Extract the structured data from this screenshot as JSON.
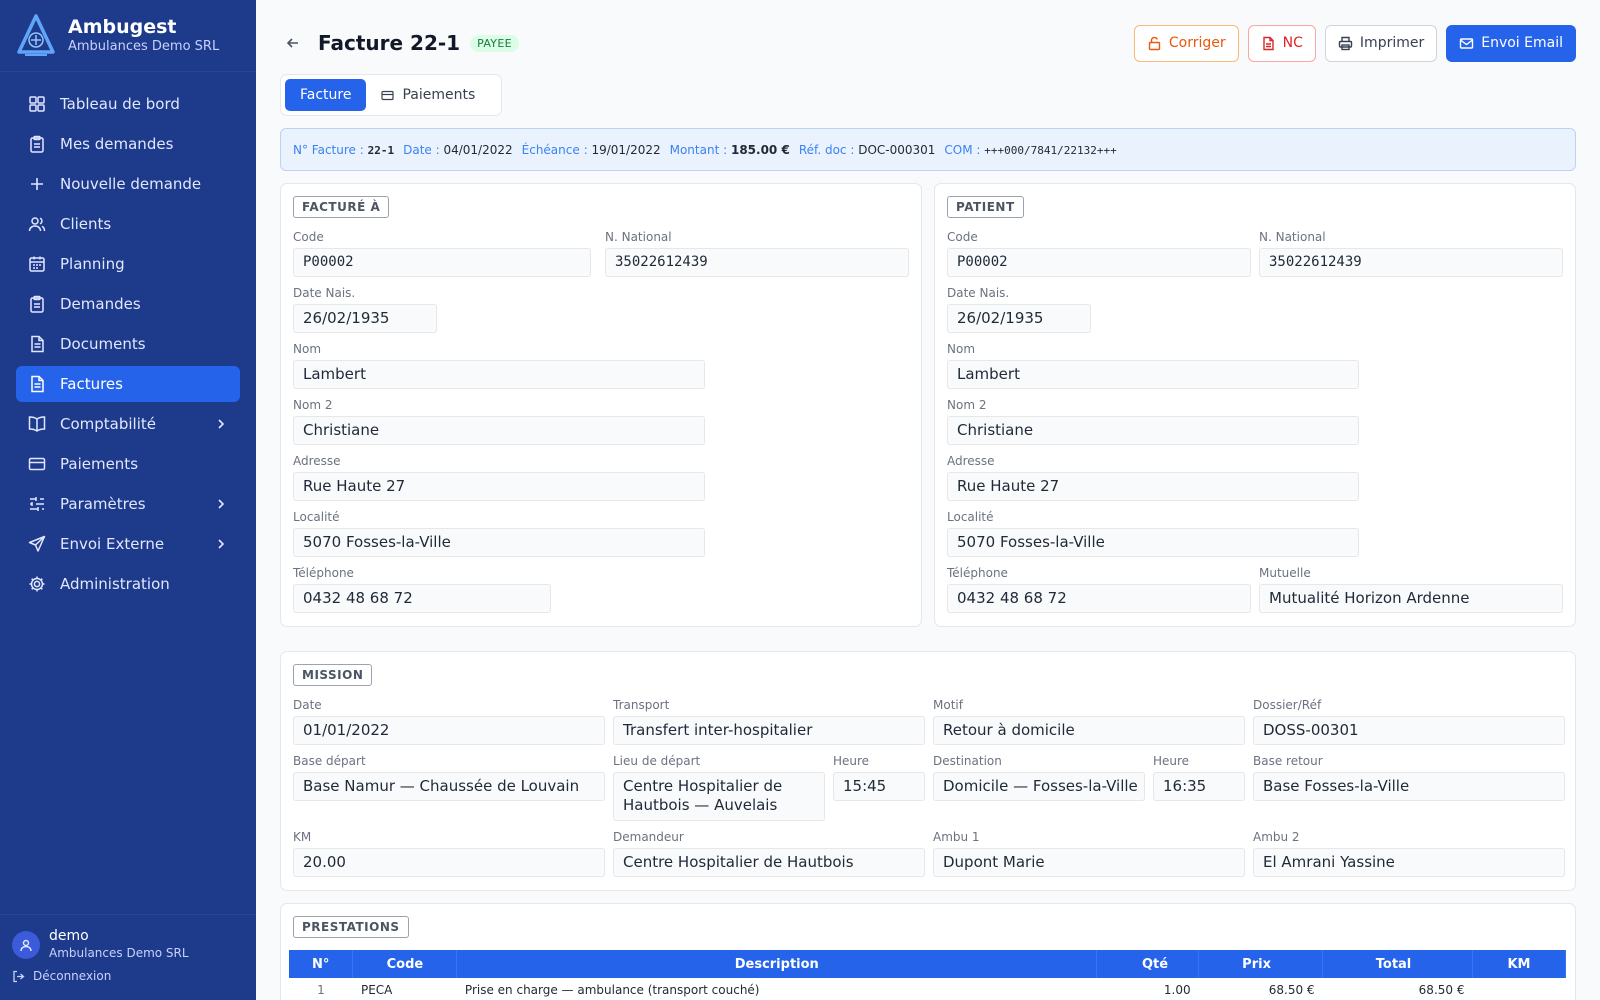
{
  "app": {
    "name": "Ambugest",
    "org": "Ambulances Demo SRL"
  },
  "sidebar": {
    "items": [
      {
        "label": "Tableau de bord",
        "icon": "dashboard-icon"
      },
      {
        "label": "Mes demandes",
        "icon": "clipboard-icon"
      },
      {
        "label": "Nouvelle demande",
        "icon": "plus-icon"
      },
      {
        "label": "Clients",
        "icon": "users-icon"
      },
      {
        "label": "Planning",
        "icon": "calendar-icon"
      },
      {
        "label": "Demandes",
        "icon": "clipboard-icon"
      },
      {
        "label": "Documents",
        "icon": "document-icon"
      },
      {
        "label": "Factures",
        "icon": "document-icon",
        "active": true
      },
      {
        "label": "Comptabilité",
        "icon": "book-icon",
        "has_children": true
      },
      {
        "label": "Paiements",
        "icon": "credit-card-icon"
      },
      {
        "label": "Paramètres",
        "icon": "sliders-icon",
        "has_children": true
      },
      {
        "label": "Envoi Externe",
        "icon": "send-icon",
        "has_children": true
      },
      {
        "label": "Administration",
        "icon": "gear-icon"
      }
    ]
  },
  "user": {
    "name": "demo",
    "org": "Ambulances Demo SRL",
    "logout_label": "Déconnexion"
  },
  "header": {
    "title": "Facture 22-1",
    "status": "PAYEE",
    "buttons": {
      "corriger": "Corriger",
      "nc": "NC",
      "imprimer": "Imprimer",
      "email": "Envoi Email"
    }
  },
  "tabs": [
    {
      "label": "Facture",
      "active": true
    },
    {
      "label": "Paiements"
    }
  ],
  "summary": {
    "num_label": "N° Facture :",
    "num": "22-1",
    "date_label": "Date :",
    "date": "04/01/2022",
    "echeance_label": "Échéance :",
    "echeance": "19/01/2022",
    "montant_label": "Montant :",
    "montant": "185.00 €",
    "ref_label": "Réf. doc :",
    "ref": "DOC-000301",
    "com_label": "COM :",
    "com": "+++000/7841/22132+++"
  },
  "labels": {
    "code": "Code",
    "n_national": "N. National",
    "date_nais": "Date Nais.",
    "nom": "Nom",
    "nom2": "Nom 2",
    "adresse": "Adresse",
    "localite": "Localité",
    "telephone": "Téléphone",
    "mutuelle": "Mutuelle"
  },
  "facture_a": {
    "title": "FACTURÉ À",
    "code": "P00002",
    "n_national": "35022612439",
    "date_nais": "26/02/1935",
    "nom": "Lambert",
    "nom2": "Christiane",
    "adresse": "Rue Haute 27",
    "localite": "5070 Fosses-la-Ville",
    "telephone": "0432 48 68 72"
  },
  "patient": {
    "title": "PATIENT",
    "code": "P00002",
    "n_national": "35022612439",
    "date_nais": "26/02/1935",
    "nom": "Lambert",
    "nom2": "Christiane",
    "adresse": "Rue Haute 27",
    "localite": "5070 Fosses-la-Ville",
    "telephone": "0432 48 68 72",
    "mutuelle": "Mutualité Horizon Ardenne"
  },
  "mission": {
    "title": "MISSION",
    "labels": {
      "date": "Date",
      "transport": "Transport",
      "motif": "Motif",
      "dossier": "Dossier/Réf",
      "base_depart": "Base départ",
      "lieu_depart": "Lieu de départ",
      "heure": "Heure",
      "destination": "Destination",
      "base_retour": "Base retour",
      "km": "KM",
      "demandeur": "Demandeur",
      "ambu1": "Ambu 1",
      "ambu2": "Ambu 2"
    },
    "date": "01/01/2022",
    "transport": "Transfert inter-hospitalier",
    "motif": "Retour à domicile",
    "dossier": "DOSS-00301",
    "base_depart": "Base Namur — Chaussée de Louvain",
    "lieu_depart": "Centre Hospitalier de Hautbois — Auvelais",
    "heure_depart": "15:45",
    "destination": "Domicile — Fosses-la-Ville",
    "heure_arrivee": "16:35",
    "base_retour": "Base Fosses-la-Ville",
    "km": "20.00",
    "demandeur": "Centre Hospitalier de Hautbois",
    "ambu1": "Dupont Marie",
    "ambu2": "El Amrani Yassine"
  },
  "prestations": {
    "title": "PRESTATIONS",
    "columns": [
      "N°",
      "Code",
      "Description",
      "Qté",
      "Prix",
      "Total",
      "KM"
    ],
    "rows": [
      {
        "n": "1",
        "code": "PECA",
        "description": "Prise en charge — ambulance (transport couché)",
        "qte": "1.00",
        "prix": "68.50 €",
        "total": "68.50 €",
        "km": ""
      }
    ]
  },
  "colors": {
    "sidebar": "#1e3a8a",
    "accent": "#2563eb",
    "paid": "#15803d"
  }
}
